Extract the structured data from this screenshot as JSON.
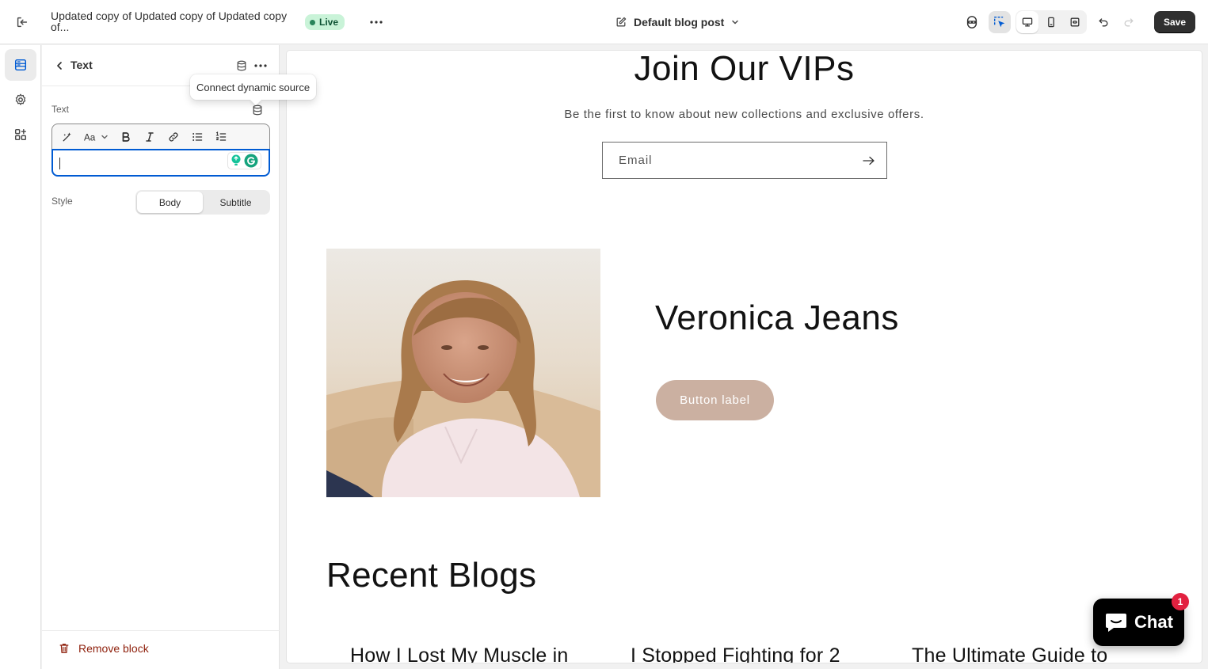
{
  "topbar": {
    "page_title_line1": "Updated copy of Updated copy of Updated copy",
    "page_title_line2": "of...",
    "status_badge": "Live",
    "template_selector": "Default blog post",
    "save_label": "Save"
  },
  "panel": {
    "title": "Text",
    "tooltip": "Connect dynamic source",
    "field_label": "Text",
    "text_value": "",
    "style_label": "Style",
    "style_options": [
      "Body",
      "Subtitle"
    ],
    "style_selected": "Body",
    "remove_label": "Remove block"
  },
  "preview": {
    "newsletter_title": "Join Our VIPs",
    "newsletter_subtitle": "Be the first to know about new collections and exclusive offers.",
    "email_placeholder": "Email",
    "person_name": "Veronica Jeans",
    "button_label": "Button label",
    "recent_title": "Recent Blogs",
    "blog_titles": [
      "How I Lost My Muscle in",
      "I Stopped Fighting for 2",
      "The Ultimate Guide to"
    ]
  },
  "chat": {
    "label": "Chat",
    "badge_count": "1"
  },
  "colors": {
    "accent": "#005bd3",
    "live_bg": "#c9f3d8",
    "button_bg": "#cbb0a1",
    "remove": "#8e1f0b"
  }
}
